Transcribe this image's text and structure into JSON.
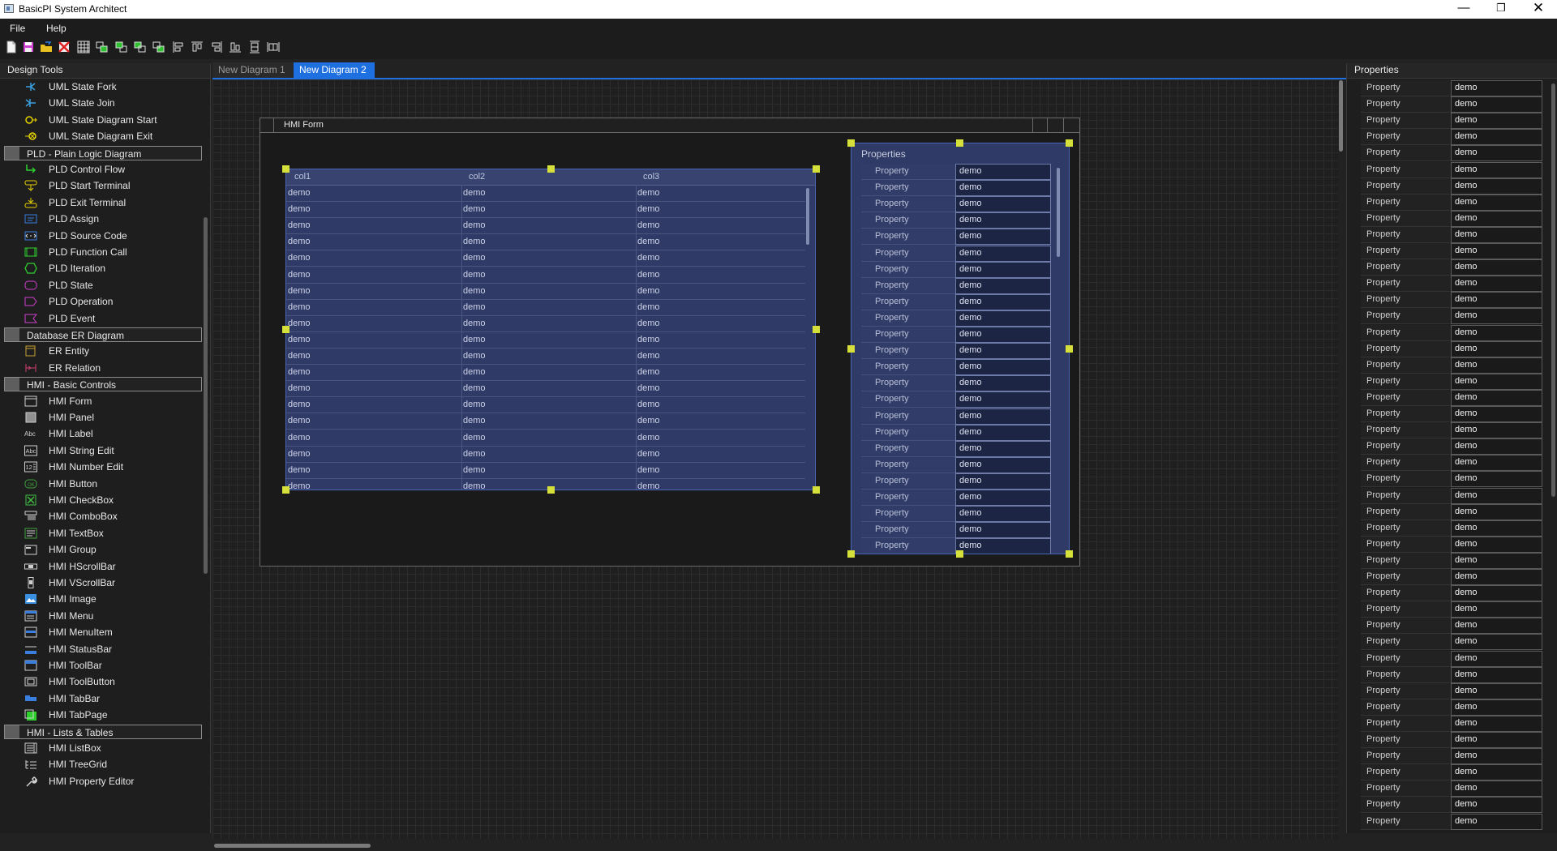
{
  "window": {
    "title": "BasicPI System Architect",
    "min": "—",
    "max": "❐",
    "close": "✕"
  },
  "menu": [
    "File",
    "Help"
  ],
  "toolbar": [
    "new",
    "save",
    "open",
    "close",
    "grid",
    "bring-front",
    "send-back",
    "front",
    "back",
    "align-left",
    "align-top",
    "align-right",
    "align-bottom",
    "same-height",
    "same-width"
  ],
  "design_tools": {
    "title": "Design Tools",
    "items": [
      {
        "kind": "tool",
        "label": "UML State Fork",
        "icon": "uml-fork",
        "color": "#3aa0e0"
      },
      {
        "kind": "tool",
        "label": "UML State Join",
        "icon": "uml-join",
        "color": "#3aa0e0"
      },
      {
        "kind": "tool",
        "label": "UML State Diagram Start",
        "icon": "uml-start",
        "color": "#e6d200"
      },
      {
        "kind": "tool",
        "label": "UML State Diagram Exit",
        "icon": "uml-exit",
        "color": "#e6d200"
      },
      {
        "kind": "category",
        "label": "PLD - Plain Logic Diagram"
      },
      {
        "kind": "tool",
        "label": "PLD Control Flow",
        "icon": "pld-flow",
        "color": "#2ed02e"
      },
      {
        "kind": "tool",
        "label": "PLD Start Terminal",
        "icon": "pld-start",
        "color": "#e6d200"
      },
      {
        "kind": "tool",
        "label": "PLD Exit Terminal",
        "icon": "pld-exit",
        "color": "#e6d200"
      },
      {
        "kind": "tool",
        "label": "PLD Assign",
        "icon": "pld-assign",
        "color": "#3a7fe0"
      },
      {
        "kind": "tool",
        "label": "PLD Source Code",
        "icon": "pld-source",
        "color": "#3a7fe0"
      },
      {
        "kind": "tool",
        "label": "PLD Function Call",
        "icon": "pld-function",
        "color": "#2ed02e"
      },
      {
        "kind": "tool",
        "label": "PLD Iteration",
        "icon": "pld-iteration",
        "color": "#2ed02e"
      },
      {
        "kind": "tool",
        "label": "PLD State",
        "icon": "pld-state",
        "color": "#d040d0"
      },
      {
        "kind": "tool",
        "label": "PLD Operation",
        "icon": "pld-operation",
        "color": "#d040d0"
      },
      {
        "kind": "tool",
        "label": "PLD Event",
        "icon": "pld-event",
        "color": "#d040d0"
      },
      {
        "kind": "category",
        "label": "Database ER Diagram"
      },
      {
        "kind": "tool",
        "label": "ER Entity",
        "icon": "er-entity",
        "color": "#c8a030"
      },
      {
        "kind": "tool",
        "label": "ER Relation",
        "icon": "er-relation",
        "color": "#d04070"
      },
      {
        "kind": "category",
        "label": "HMI - Basic Controls"
      },
      {
        "kind": "tool",
        "label": "HMI Form",
        "icon": "hmi-form",
        "color": "#d0d0d0"
      },
      {
        "kind": "tool",
        "label": "HMI Panel",
        "icon": "hmi-panel",
        "color": "#909090"
      },
      {
        "kind": "tool",
        "label": "HMI Label",
        "icon": "hmi-label",
        "color": "#d0d0d0"
      },
      {
        "kind": "tool",
        "label": "HMI String Edit",
        "icon": "hmi-string-edit",
        "color": "#d0d0d0"
      },
      {
        "kind": "tool",
        "label": "HMI Number Edit",
        "icon": "hmi-number-edit",
        "color": "#d0d0d0"
      },
      {
        "kind": "tool",
        "label": "HMI Button",
        "icon": "hmi-button",
        "color": "#40a040"
      },
      {
        "kind": "tool",
        "label": "HMI CheckBox",
        "icon": "hmi-checkbox",
        "color": "#40c040"
      },
      {
        "kind": "tool",
        "label": "HMI ComboBox",
        "icon": "hmi-combobox",
        "color": "#d0d0d0"
      },
      {
        "kind": "tool",
        "label": "HMI TextBox",
        "icon": "hmi-textbox",
        "color": "#40a040"
      },
      {
        "kind": "tool",
        "label": "HMI Group",
        "icon": "hmi-group",
        "color": "#d0d0d0"
      },
      {
        "kind": "tool",
        "label": "HMI HScrollBar",
        "icon": "hmi-hscrollbar",
        "color": "#d0d0d0"
      },
      {
        "kind": "tool",
        "label": "HMI VScrollBar",
        "icon": "hmi-vscrollbar",
        "color": "#d0d0d0"
      },
      {
        "kind": "tool",
        "label": "HMI Image",
        "icon": "hmi-image",
        "color": "#3a8fe0"
      },
      {
        "kind": "tool",
        "label": "HMI Menu",
        "icon": "hmi-menu",
        "color": "#3a7fe0"
      },
      {
        "kind": "tool",
        "label": "HMI MenuItem",
        "icon": "hmi-menuitem",
        "color": "#3a7fe0"
      },
      {
        "kind": "tool",
        "label": "HMI StatusBar",
        "icon": "hmi-statusbar",
        "color": "#3a7fe0"
      },
      {
        "kind": "tool",
        "label": "HMI ToolBar",
        "icon": "hmi-toolbar",
        "color": "#3a7fe0"
      },
      {
        "kind": "tool",
        "label": "HMI ToolButton",
        "icon": "hmi-toolbutton",
        "color": "#d0d0d0"
      },
      {
        "kind": "tool",
        "label": "HMI TabBar",
        "icon": "hmi-tabbar",
        "color": "#3a7fe0"
      },
      {
        "kind": "tool",
        "label": "HMI TabPage",
        "icon": "hmi-tabpage",
        "color": "#2ed02e"
      },
      {
        "kind": "category",
        "label": "HMI - Lists & Tables"
      },
      {
        "kind": "tool",
        "label": "HMI ListBox",
        "icon": "hmi-listbox",
        "color": "#d0d0d0"
      },
      {
        "kind": "tool",
        "label": "HMI TreeGrid",
        "icon": "hmi-treegrid",
        "color": "#d0d0d0"
      },
      {
        "kind": "tool",
        "label": "HMI Property Editor",
        "icon": "hmi-property-editor",
        "color": "#d0d0d0"
      }
    ]
  },
  "tabs": [
    {
      "label": "New Diagram 1",
      "active": false
    },
    {
      "label": "New Diagram 2",
      "active": true
    }
  ],
  "hmi_form": {
    "title": "HMI Form",
    "grid": {
      "columns": [
        "col1",
        "col2",
        "col3"
      ],
      "rows": [
        [
          "demo",
          "demo",
          "demo"
        ],
        [
          "demo",
          "demo",
          "demo"
        ],
        [
          "demo",
          "demo",
          "demo"
        ],
        [
          "demo",
          "demo",
          "demo"
        ],
        [
          "demo",
          "demo",
          "demo"
        ],
        [
          "demo",
          "demo",
          "demo"
        ],
        [
          "demo",
          "demo",
          "demo"
        ],
        [
          "demo",
          "demo",
          "demo"
        ],
        [
          "demo",
          "demo",
          "demo"
        ],
        [
          "demo",
          "demo",
          "demo"
        ],
        [
          "demo",
          "demo",
          "demo"
        ],
        [
          "demo",
          "demo",
          "demo"
        ],
        [
          "demo",
          "demo",
          "demo"
        ],
        [
          "demo",
          "demo",
          "demo"
        ],
        [
          "demo",
          "demo",
          "demo"
        ],
        [
          "demo",
          "demo",
          "demo"
        ],
        [
          "demo",
          "demo",
          "demo"
        ],
        [
          "demo",
          "demo",
          "demo"
        ],
        [
          "demo",
          "demo",
          "demo"
        ]
      ]
    },
    "property_panel": {
      "title": "Properties",
      "rows": [
        [
          "Property",
          "demo"
        ],
        [
          "Property",
          "demo"
        ],
        [
          "Property",
          "demo"
        ],
        [
          "Property",
          "demo"
        ],
        [
          "Property",
          "demo"
        ],
        [
          "Property",
          "demo"
        ],
        [
          "Property",
          "demo"
        ],
        [
          "Property",
          "demo"
        ],
        [
          "Property",
          "demo"
        ],
        [
          "Property",
          "demo"
        ],
        [
          "Property",
          "demo"
        ],
        [
          "Property",
          "demo"
        ],
        [
          "Property",
          "demo"
        ],
        [
          "Property",
          "demo"
        ],
        [
          "Property",
          "demo"
        ],
        [
          "Property",
          "demo"
        ],
        [
          "Property",
          "demo"
        ],
        [
          "Property",
          "demo"
        ],
        [
          "Property",
          "demo"
        ],
        [
          "Property",
          "demo"
        ],
        [
          "Property",
          "demo"
        ],
        [
          "Property",
          "demo"
        ],
        [
          "Property",
          "demo"
        ],
        [
          "Property",
          "demo"
        ]
      ]
    }
  },
  "properties_dock": {
    "title": "Properties",
    "rows": [
      [
        "Property",
        "demo"
      ],
      [
        "Property",
        "demo"
      ],
      [
        "Property",
        "demo"
      ],
      [
        "Property",
        "demo"
      ],
      [
        "Property",
        "demo"
      ],
      [
        "Property",
        "demo"
      ],
      [
        "Property",
        "demo"
      ],
      [
        "Property",
        "demo"
      ],
      [
        "Property",
        "demo"
      ],
      [
        "Property",
        "demo"
      ],
      [
        "Property",
        "demo"
      ],
      [
        "Property",
        "demo"
      ],
      [
        "Property",
        "demo"
      ],
      [
        "Property",
        "demo"
      ],
      [
        "Property",
        "demo"
      ],
      [
        "Property",
        "demo"
      ],
      [
        "Property",
        "demo"
      ],
      [
        "Property",
        "demo"
      ],
      [
        "Property",
        "demo"
      ],
      [
        "Property",
        "demo"
      ],
      [
        "Property",
        "demo"
      ],
      [
        "Property",
        "demo"
      ],
      [
        "Property",
        "demo"
      ],
      [
        "Property",
        "demo"
      ],
      [
        "Property",
        "demo"
      ],
      [
        "Property",
        "demo"
      ],
      [
        "Property",
        "demo"
      ],
      [
        "Property",
        "demo"
      ],
      [
        "Property",
        "demo"
      ],
      [
        "Property",
        "demo"
      ],
      [
        "Property",
        "demo"
      ],
      [
        "Property",
        "demo"
      ],
      [
        "Property",
        "demo"
      ],
      [
        "Property",
        "demo"
      ],
      [
        "Property",
        "demo"
      ],
      [
        "Property",
        "demo"
      ],
      [
        "Property",
        "demo"
      ],
      [
        "Property",
        "demo"
      ],
      [
        "Property",
        "demo"
      ],
      [
        "Property",
        "demo"
      ],
      [
        "Property",
        "demo"
      ],
      [
        "Property",
        "demo"
      ],
      [
        "Property",
        "demo"
      ],
      [
        "Property",
        "demo"
      ],
      [
        "Property",
        "demo"
      ],
      [
        "Property",
        "demo"
      ]
    ]
  },
  "colors": {
    "accent": "#1e6fe0",
    "handle": "#d6e03a",
    "widget_bg": "#2f3a66"
  }
}
